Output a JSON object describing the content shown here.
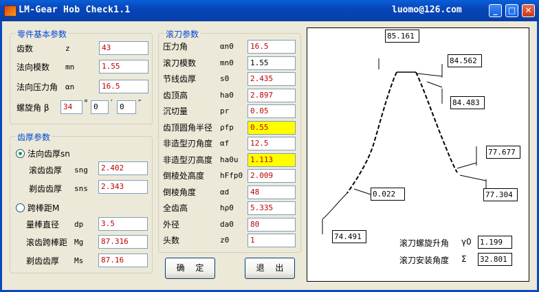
{
  "window": {
    "title": "LM-Gear Hob Check1.1",
    "email": "luomo@126.com",
    "min_glyph": "_",
    "max_glyph": "□",
    "close_glyph": "✕"
  },
  "basic": {
    "title": "零件基本参数",
    "rows": [
      {
        "label": "齿数",
        "symbol": "z",
        "value": "43"
      },
      {
        "label": "法向模数",
        "symbol": "mn",
        "value": "1.55"
      },
      {
        "label": "法向压力角",
        "symbol": "αn",
        "value": "16.5"
      }
    ],
    "helix": {
      "label": "螺旋角 β",
      "deg": "34",
      "deg_unit": "°",
      "min": "0",
      "min_unit": "′",
      "sec": "0",
      "sec_unit": "″"
    }
  },
  "thickness": {
    "title": "齿厚参数",
    "normal": {
      "label": "法向齿厚sn",
      "rows": [
        {
          "label": "滚齿齿厚",
          "symbol": "sng",
          "value": "2.402"
        },
        {
          "label": "剃齿齿厚",
          "symbol": "sns",
          "value": "2.343"
        }
      ]
    },
    "pin": {
      "label": "跨棒距M",
      "rows": [
        {
          "label": "量棒直径",
          "symbol": "dp",
          "value": "3.5"
        },
        {
          "label": "滚齿跨棒距",
          "symbol": "Mg",
          "value": "87.316"
        },
        {
          "label": "剃齿齿厚",
          "symbol": "Ms",
          "value": "87.16"
        }
      ]
    }
  },
  "hob": {
    "title": "滚刀参数",
    "rows": [
      {
        "label": "压力角",
        "symbol": "αn0",
        "value": "16.5"
      },
      {
        "label": "滚刀模数",
        "symbol": "mn0",
        "value": "1.55"
      },
      {
        "label": "节线齿厚",
        "symbol": "s0",
        "value": "2.435"
      },
      {
        "label": "齿顶高",
        "symbol": "ha0",
        "value": "2.897"
      },
      {
        "label": "沉切量",
        "symbol": "pr",
        "value": "0.05"
      },
      {
        "label": "齿顶圆角半径",
        "symbol": "ρfp",
        "value": "0.55",
        "highlight": true
      },
      {
        "label": "非造型刃角度",
        "symbol": "αf",
        "value": "12.5"
      },
      {
        "label": "非造型刃高度",
        "symbol": "ha0u",
        "value": "1.113",
        "highlight": true
      },
      {
        "label": "倒棱处高度",
        "symbol": "hFfp0",
        "value": "2.009"
      },
      {
        "label": "倒棱角度",
        "symbol": "αd",
        "value": "48"
      },
      {
        "label": "全齿高",
        "symbol": "hρ0",
        "value": "5.335"
      },
      {
        "label": "外径",
        "symbol": "da0",
        "value": "80"
      },
      {
        "label": "头数",
        "symbol": "z0",
        "value": "1"
      }
    ]
  },
  "buttons": {
    "ok": "确 定",
    "exit": "退 出"
  },
  "diagram": {
    "values": {
      "tip_left": "85.161",
      "tip_right": "84.562",
      "right_upper": "84.483",
      "right_mid_upper": "77.677",
      "right_mid_lower": "77.304",
      "left_gap": "0.022",
      "root_left": "74.491"
    },
    "lead_angle": {
      "label": "滚刀螺旋升角",
      "symbol": "γ0",
      "value": "1.199"
    },
    "setting_angle": {
      "label": "滚刀安装角度",
      "symbol": "Σ",
      "value": "32.801"
    }
  }
}
